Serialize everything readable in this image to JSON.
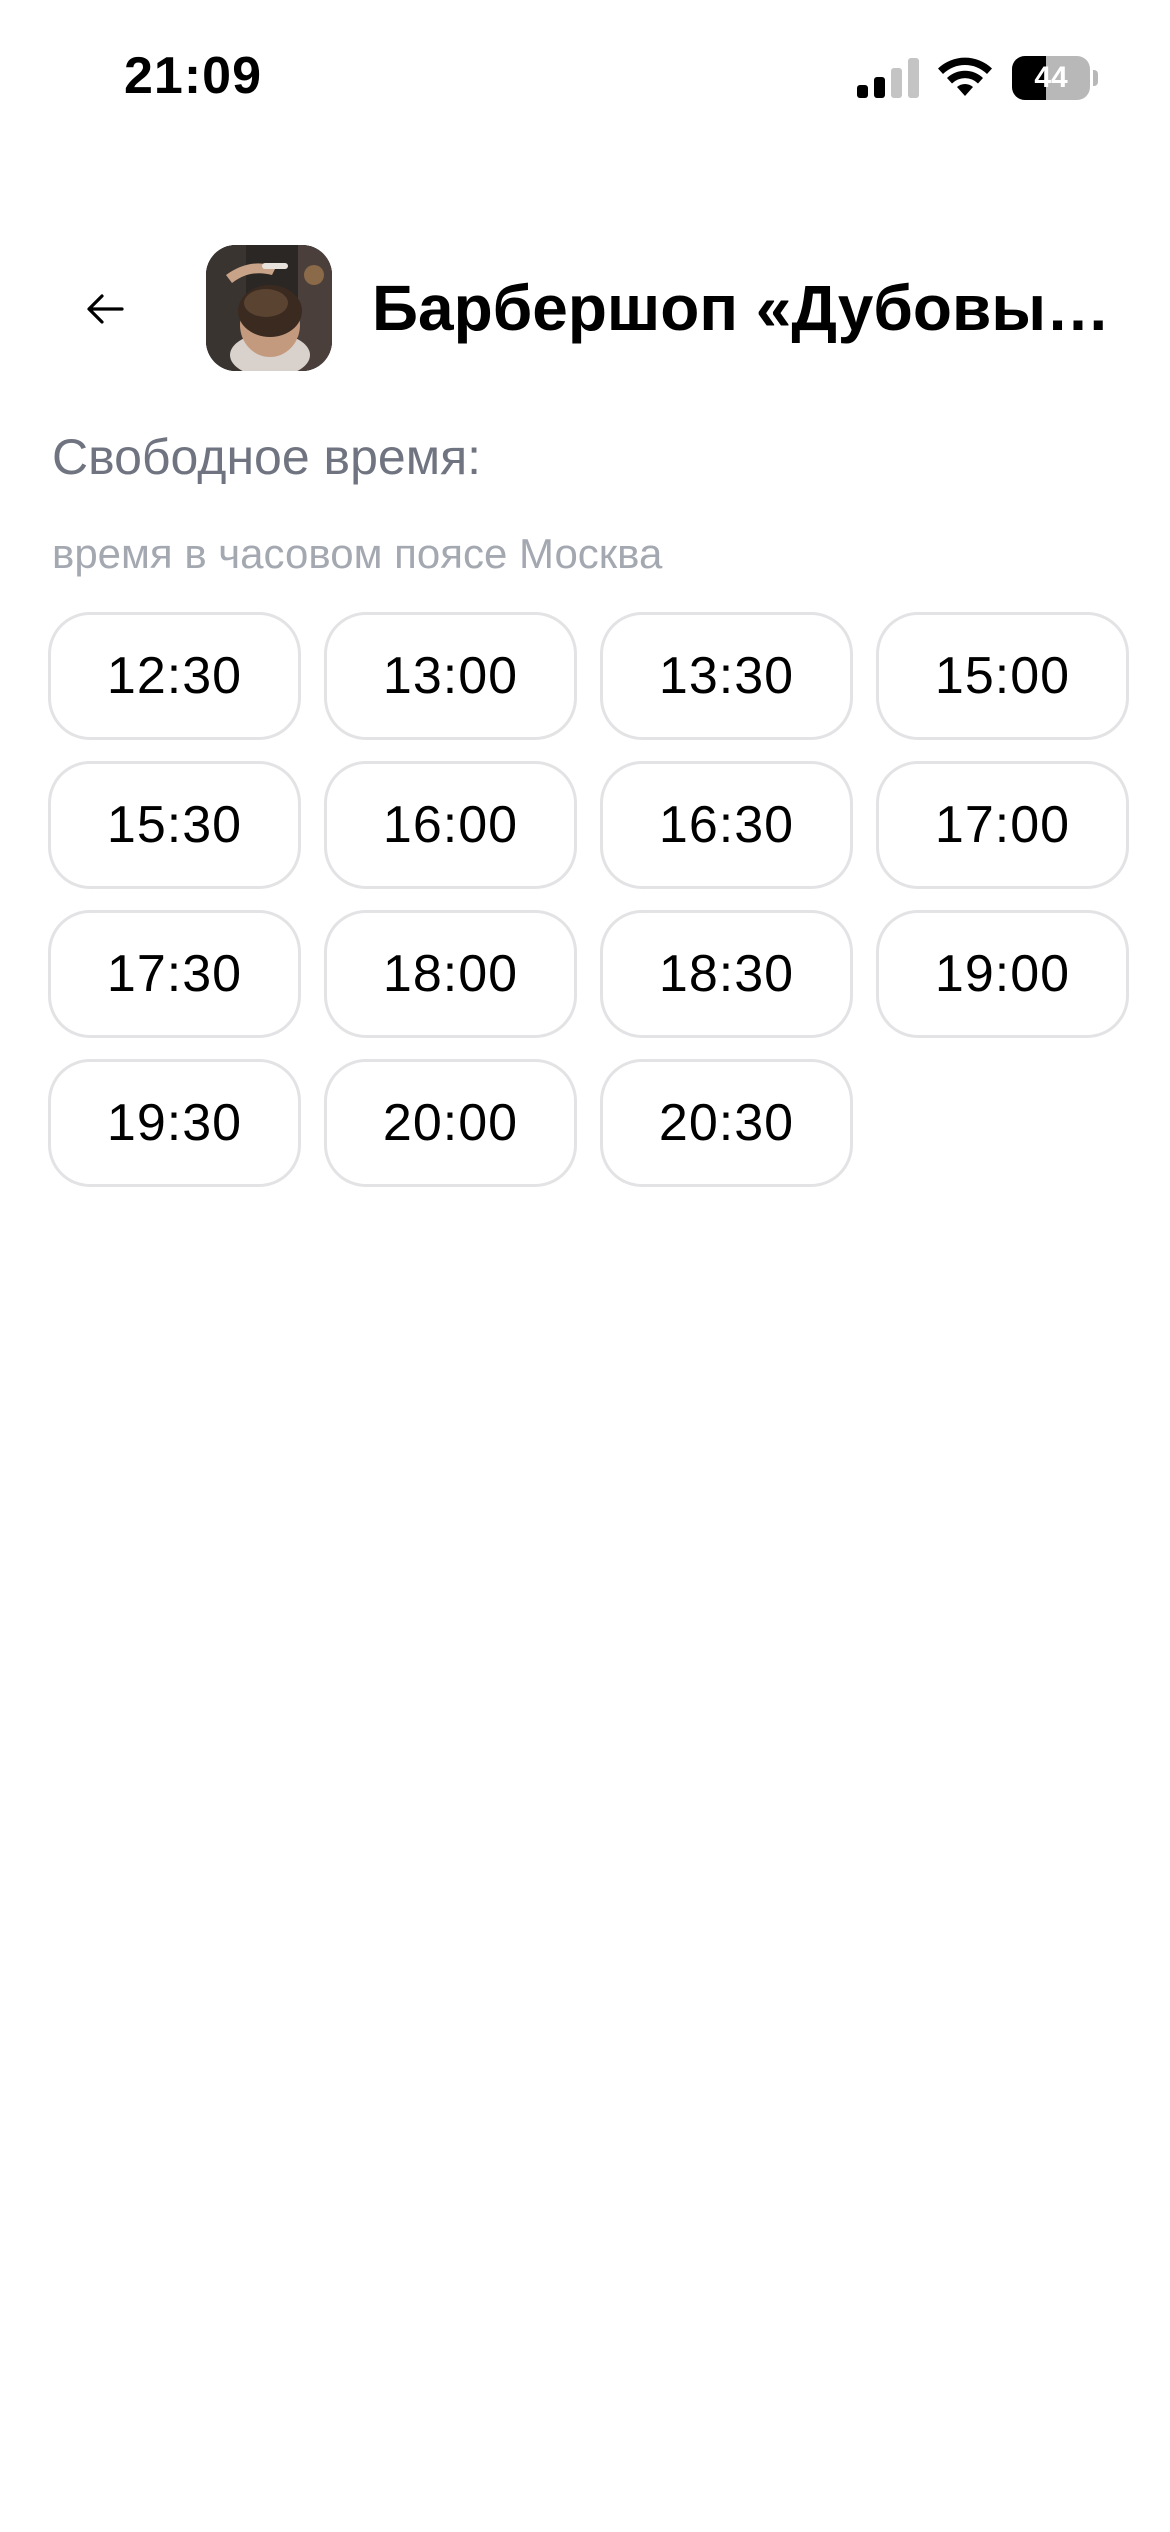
{
  "status_bar": {
    "time": "21:09",
    "battery_level": "44",
    "battery_fraction": 0.44,
    "signal_bars_active": 2,
    "signal_bars_total": 4
  },
  "header": {
    "back_icon": "arrow-left-icon",
    "title": "Барбершоп «Дубовы…"
  },
  "main": {
    "section_title": "Свободное время:",
    "timezone_note": "время в часовом поясе Москва",
    "slots": [
      "12:30",
      "13:00",
      "13:30",
      "15:00",
      "15:30",
      "16:00",
      "16:30",
      "17:00",
      "17:30",
      "18:00",
      "18:30",
      "19:00",
      "19:30",
      "20:00",
      "20:30"
    ]
  },
  "colors": {
    "text_primary": "#000000",
    "text_secondary": "#6f7480",
    "text_tertiary": "#a4a8b0",
    "slot_border": "#e3e3e6",
    "background": "#ffffff"
  }
}
